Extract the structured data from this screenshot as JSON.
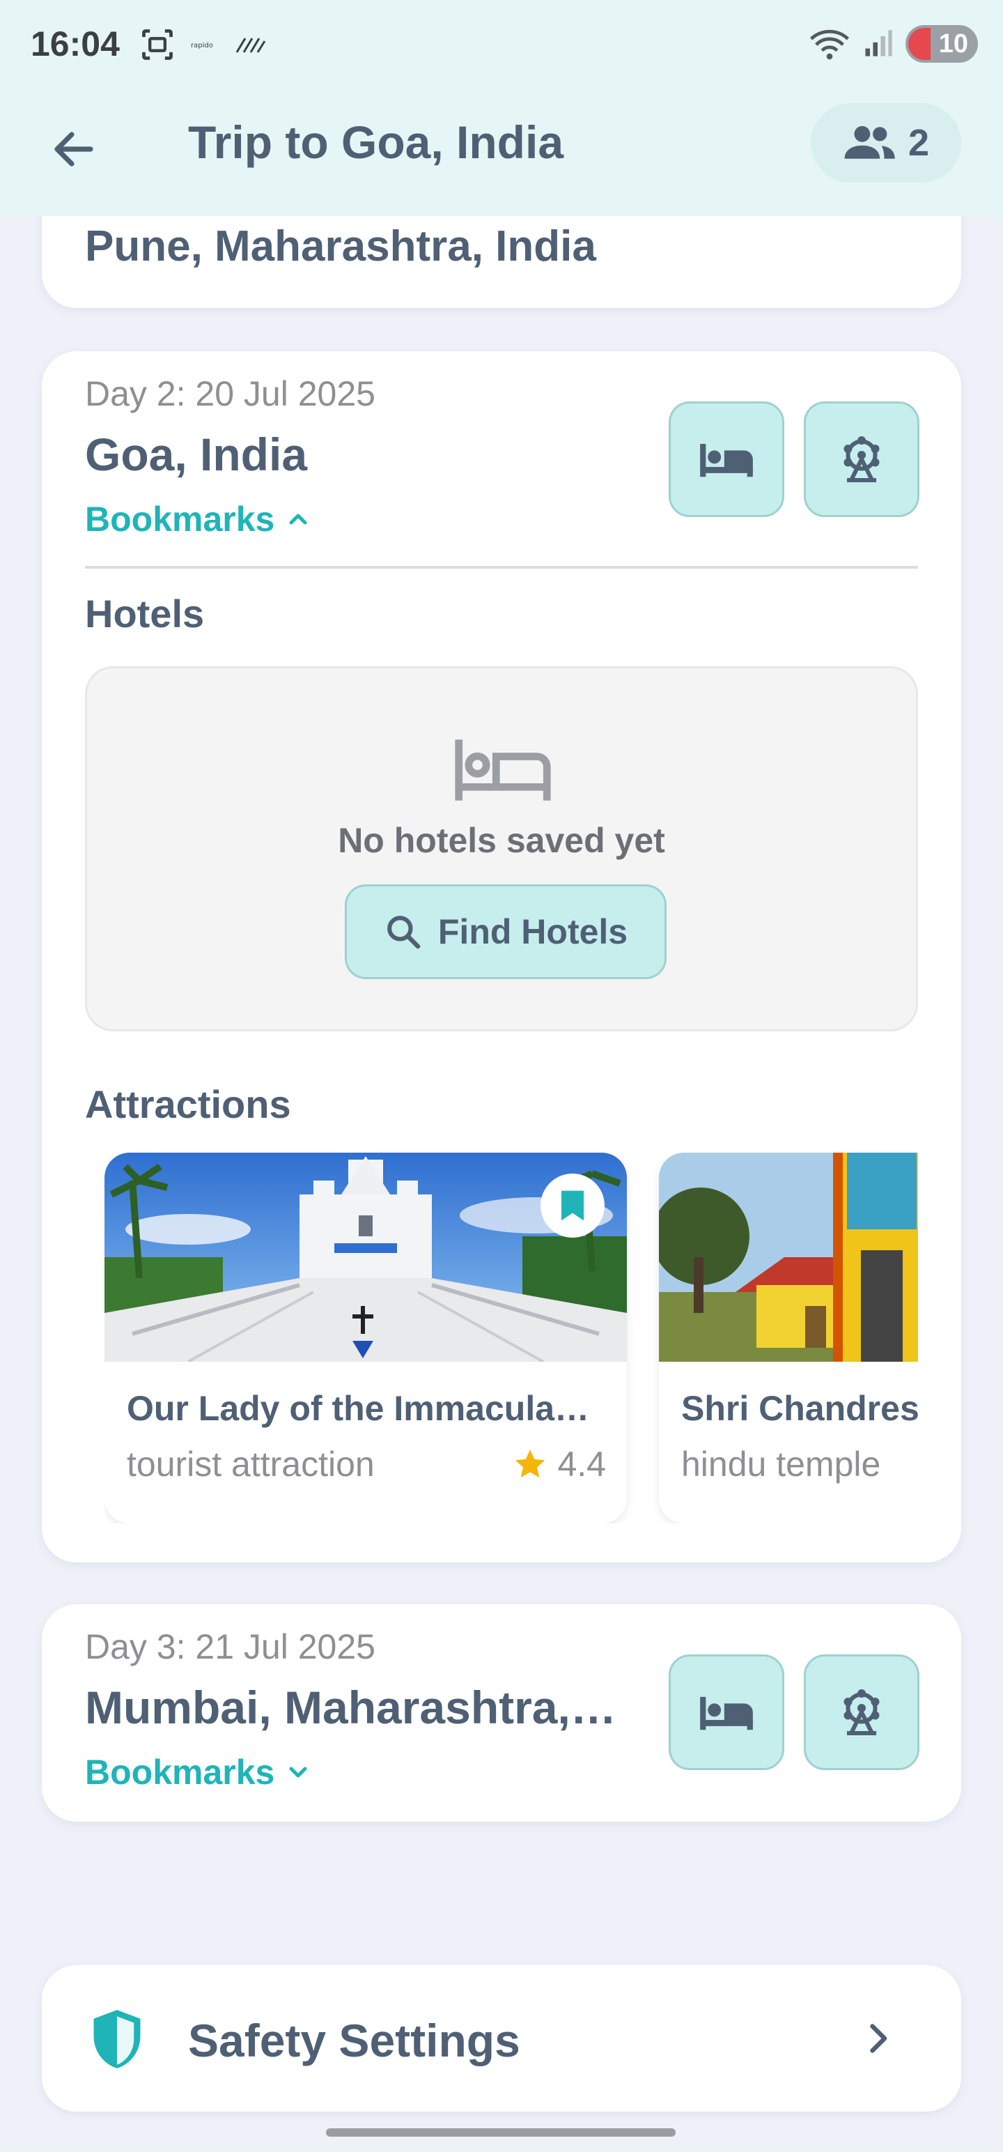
{
  "status_bar": {
    "time": "16:04",
    "left_icons": [
      "screenshot-icon",
      "rapido-icon",
      "slash-icon"
    ],
    "right_icons": [
      "wifi-icon",
      "signal-icon"
    ],
    "battery": "10"
  },
  "header": {
    "title": "Trip to Goa, India",
    "back_icon": "arrow-back-icon",
    "members_icon": "group-icon",
    "members_count": "2"
  },
  "previous_day": {
    "location": "Pune, Maharashtra, India"
  },
  "day2": {
    "label": "Day 2: 20 Jul 2025",
    "location": "Goa, India",
    "bookmarks_label": "Bookmarks",
    "bookmarks_expanded": true,
    "hotels": {
      "title": "Hotels",
      "empty_text": "No hotels saved yet",
      "find_button": "Find Hotels"
    },
    "attractions": {
      "title": "Attractions",
      "items": [
        {
          "name": "Our Lady of the Immacula…",
          "type": "tourist attraction",
          "rating": "4.4",
          "bookmarked": true
        },
        {
          "name": "Shri Chandres",
          "type": "hindu temple"
        }
      ]
    }
  },
  "day3": {
    "label": "Day 3: 21 Jul 2025",
    "location": "Mumbai, Maharashtra,…",
    "bookmarks_label": "Bookmarks",
    "bookmarks_expanded": false
  },
  "safety": {
    "label": "Safety Settings",
    "icon": "shield-icon"
  },
  "colors": {
    "accent": "#1fb4b8",
    "button_fill": "#c6eeed",
    "text_primary": "#4f6075",
    "star": "#f5b50a"
  }
}
